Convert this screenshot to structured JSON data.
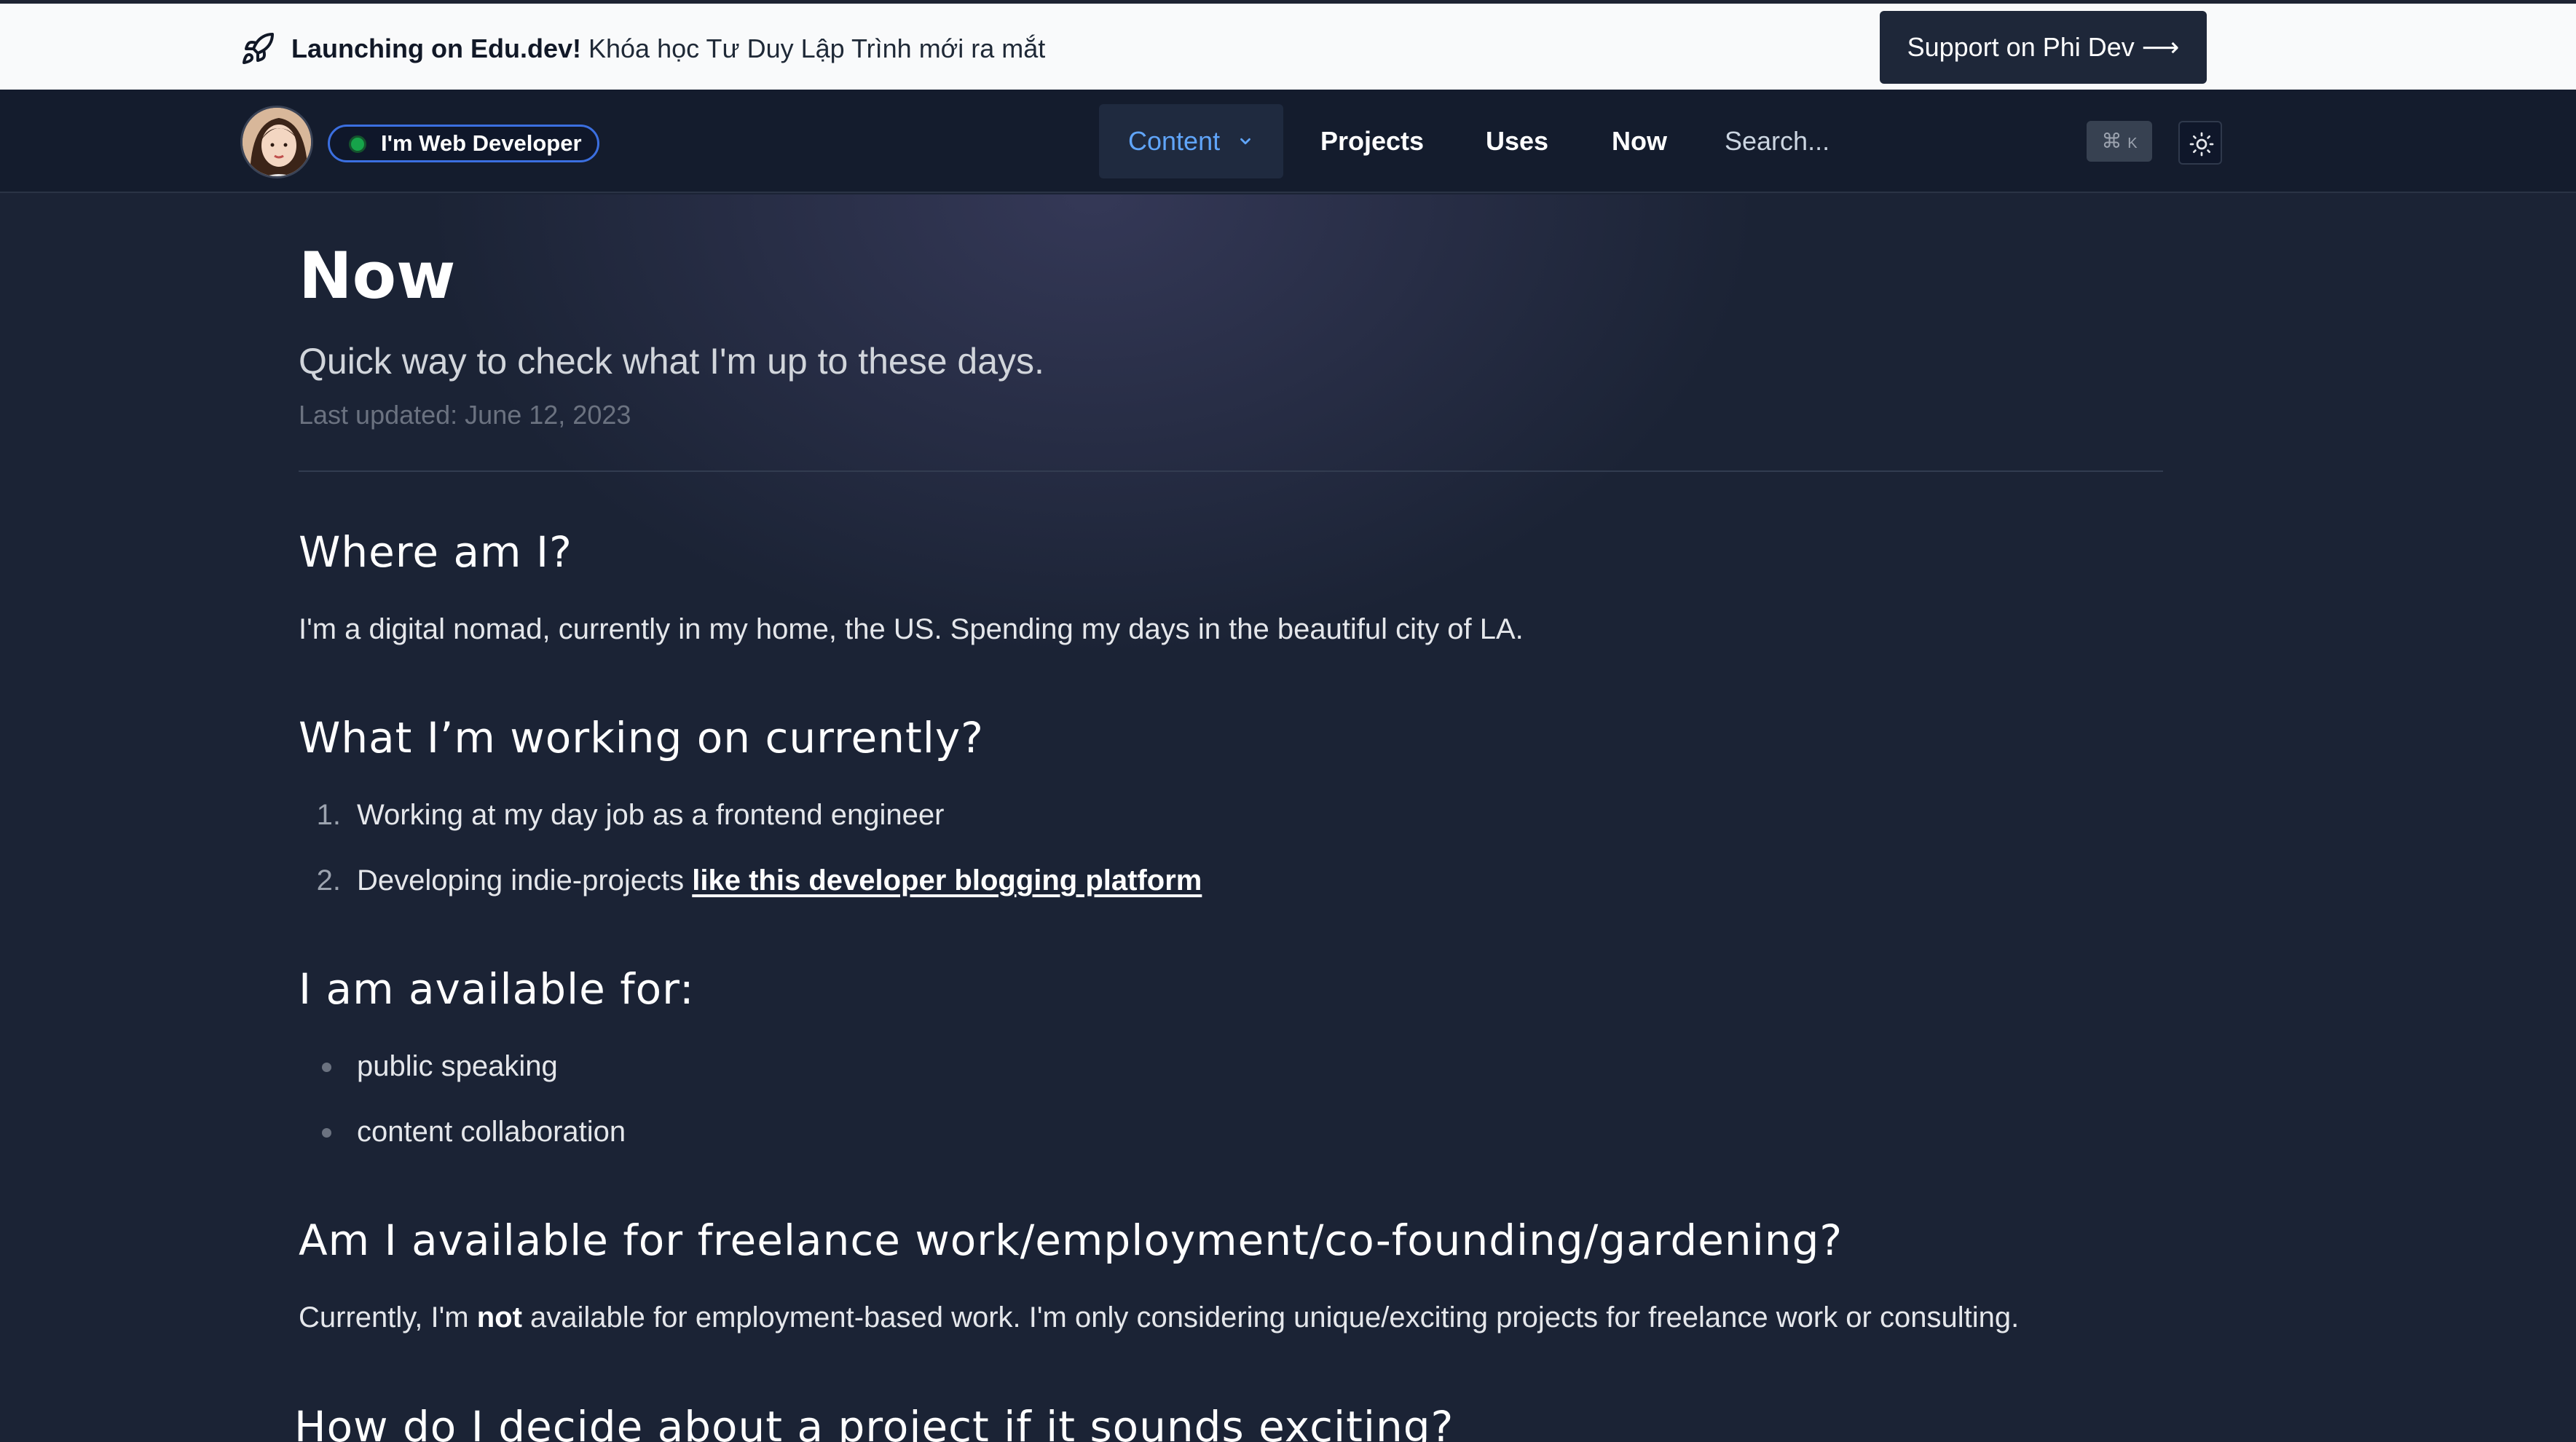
{
  "announcement": {
    "highlight": "Launching on Edu.dev!",
    "text": " Khóa học Tư Duy Lập Trình mới ra mắt",
    "cta_label": "Support on Phi Dev ⟶"
  },
  "nav": {
    "badge_label": "I'm Web Developer",
    "content_label": "Content",
    "links": [
      "Projects",
      "Uses",
      "Now"
    ],
    "search_placeholder": "Search...",
    "shortcut_symbol": "⌘",
    "shortcut_key": "K"
  },
  "page": {
    "title": "Now",
    "subtitle": "Quick way to check what I'm up to these days.",
    "last_updated": "Last updated: June 12, 2023"
  },
  "sections": {
    "where": {
      "heading": "Where am I?",
      "body": "I'm a digital nomad, currently in my home, the US. Spending my days in the beautiful city of LA."
    },
    "working": {
      "heading": "What I’m working on currently?",
      "items": [
        {
          "num": "1.",
          "text": "Working at my day job as a frontend engineer",
          "link": ""
        },
        {
          "num": "2.",
          "text": "Developing indie-projects ",
          "link": "like this developer blogging platform"
        }
      ]
    },
    "available": {
      "heading": "I am available for:",
      "items": [
        "public speaking",
        "content collaboration"
      ]
    },
    "freelance": {
      "heading": "Am I available for freelance work/employment/co-founding/gardening?",
      "body_before": "Currently, I'm ",
      "body_bold": "not",
      "body_after": " available for employment-based work. I'm only considering unique/exciting projects for freelance work or consulting."
    },
    "decide": {
      "heading": "How do I decide about a project if it sounds exciting?"
    }
  },
  "colors": {
    "background": "#1b2335",
    "navbar": "#141c2d",
    "accent_blue": "#60a5fa",
    "badge_border": "#3b6fe0",
    "status_green": "#16a34a"
  },
  "icons": {
    "announcement": "rocket-icon",
    "content_menu": "chevron-down-icon",
    "theme_toggle": "sun-icon"
  }
}
